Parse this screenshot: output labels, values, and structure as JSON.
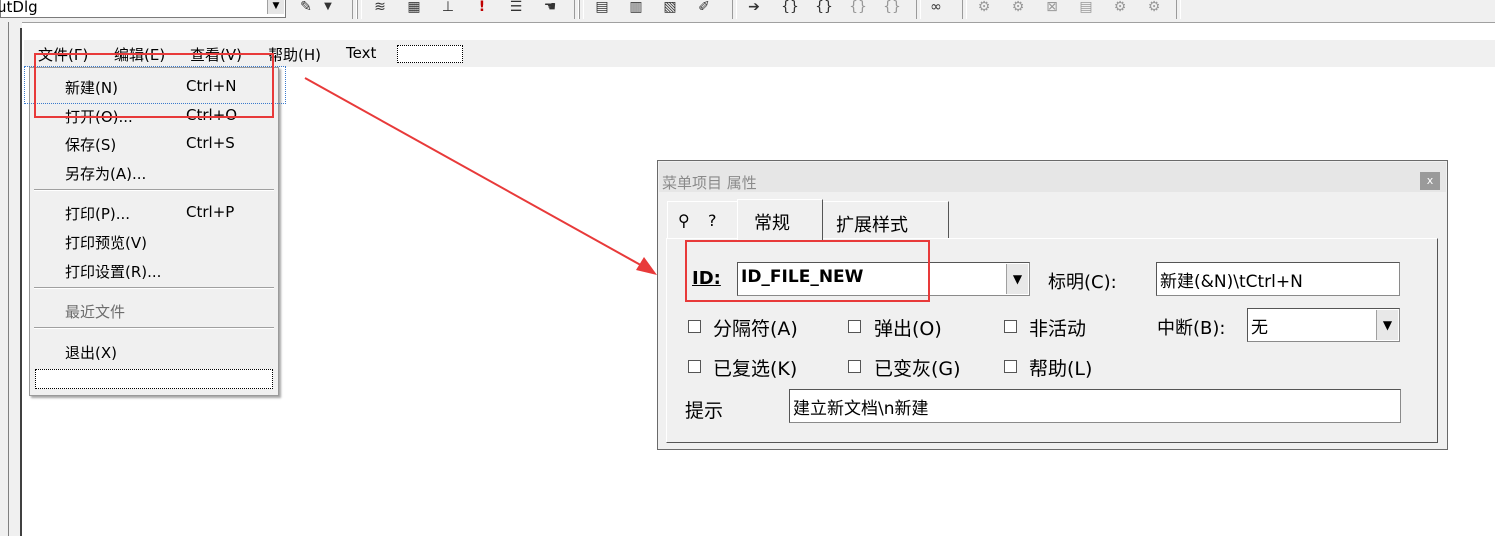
{
  "toolbar": {
    "combo_value": "utDlg",
    "icons": [
      "wizard-icon",
      "layout-icon",
      "bring-icon",
      "align-icon",
      "exclamation-icon",
      "tab-order-icon",
      "hand-icon",
      "class-icon",
      "edit-icon",
      "list-icon",
      "note-icon",
      "arrow-right-icon",
      "brace1-icon",
      "brace2-icon",
      "brace3-icon",
      "brace4-icon",
      "binoculars-icon",
      "tool1-icon",
      "tool2-icon",
      "tool3-icon",
      "tool4-icon",
      "tool5-icon",
      "tool6-icon"
    ]
  },
  "menubar": {
    "items": [
      "文件(F)",
      "编辑(E)",
      "查看(V)",
      "帮助(H)",
      "Text"
    ]
  },
  "dropdown": {
    "items": [
      {
        "label": "新建(N)",
        "shortcut": "Ctrl+N"
      },
      {
        "label": "打开(O)...",
        "shortcut": "Ctrl+O"
      },
      {
        "label": "保存(S)",
        "shortcut": "Ctrl+S"
      },
      {
        "label": "另存为(A)...",
        "shortcut": ""
      },
      {
        "label": "打印(P)...",
        "shortcut": "Ctrl+P"
      },
      {
        "label": "打印预览(V)",
        "shortcut": ""
      },
      {
        "label": "打印设置(R)...",
        "shortcut": ""
      },
      {
        "label": "最近文件",
        "shortcut": ""
      },
      {
        "label": "退出(X)",
        "shortcut": ""
      }
    ]
  },
  "dialog": {
    "title": "菜单项目 属性",
    "close": "x",
    "tabs": [
      "常规",
      "扩展样式"
    ],
    "id_label": "ID:",
    "id_value": "ID_FILE_NEW",
    "caption_label": "标明(C):",
    "caption_value": "新建(&N)\\tCtrl+N",
    "checkboxes": [
      "分隔符(A)",
      "弹出(O)",
      "非活动",
      "已复选(K)",
      "已变灰(G)",
      "帮助(L)"
    ],
    "break_label": "中断(B):",
    "break_value": "无",
    "prompt_label": "提示",
    "prompt_value": "建立新文档\\n新建"
  },
  "colors": {
    "highlight_red": "#e83a3a",
    "dialog_bg": "#f0f0f0",
    "title_gray": "#8a8a8a"
  }
}
